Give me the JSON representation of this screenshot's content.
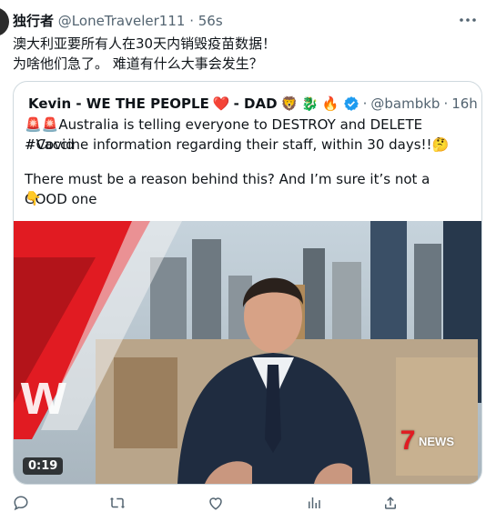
{
  "tweet": {
    "author": "独行者",
    "handle": "@LoneTraveler111",
    "separator": "·",
    "time": "56s",
    "line1": "澳大利亚要所有人在30天内销毁疫苗数据！",
    "line2": "为啥他们急了。 难道有什么大事会发生？"
  },
  "quote": {
    "author": "Kevin - WE THE PEOPLE",
    "author_suffix": "- DAD",
    "handle": "@bambkb",
    "separator": "·",
    "time": "16h",
    "line1": "Australia is telling everyone to DESTROY and DELETE #Covid",
    "line2": "#Vaccine information regarding their staff, within 30 days!!",
    "line3": "There must be a reason behind this? And I’m sure it’s not a GOOD one",
    "emojis": {
      "heart": "❤️",
      "lion": "🦁",
      "dragon": "🐉",
      "fire": "🔥",
      "siren": "🚨",
      "thinking": "🤔",
      "point_down": "👇"
    },
    "video": {
      "duration": "0:19",
      "logo": "NEWS",
      "channel_mark": "7"
    }
  },
  "actions": {
    "reply_icon": "reply-icon",
    "retweet_icon": "retweet-icon",
    "like_icon": "like-icon",
    "views_icon": "views-icon",
    "share_icon": "share-icon"
  },
  "colors": {
    "text": "#0f1419",
    "secondary": "#536471",
    "link": "#1d9bf0",
    "border": "#cfd9de",
    "news_red": "#e11b22"
  }
}
